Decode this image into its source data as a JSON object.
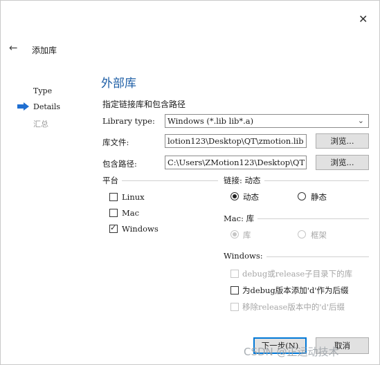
{
  "window": {
    "title": "添加库",
    "close_symbol": "✕",
    "back_symbol": "←"
  },
  "steps": [
    {
      "label": "Type",
      "active": false
    },
    {
      "label": "Details",
      "active": true
    },
    {
      "label": "汇总",
      "active": false
    }
  ],
  "page": {
    "title": "外部库",
    "subtitle": "指定链接库和包含路径"
  },
  "form": {
    "library_type": {
      "label": "Library type:",
      "value": "Windows (*.lib lib*.a)"
    },
    "library_file": {
      "label": "库文件:",
      "value": "lotion123\\Desktop\\QT\\zmotion.lib",
      "browse_label": "浏览..."
    },
    "include_path": {
      "label": "包含路径:",
      "value": "C:\\Users\\ZMotion123\\Desktop\\QT",
      "browse_label": "浏览..."
    }
  },
  "platform": {
    "title": "平台",
    "options": [
      {
        "label": "Linux",
        "checked": false
      },
      {
        "label": "Mac",
        "checked": false
      },
      {
        "label": "Windows",
        "checked": true
      }
    ]
  },
  "linking": {
    "title": "链接: 动态",
    "options": [
      {
        "label": "动态",
        "selected": true
      },
      {
        "label": "静态",
        "selected": false
      }
    ]
  },
  "mac": {
    "title": "Mac: 库",
    "options": [
      {
        "label": "库",
        "selected": true,
        "disabled": true
      },
      {
        "label": "框架",
        "selected": false,
        "disabled": true
      }
    ]
  },
  "windows": {
    "title": "Windows:",
    "options": [
      {
        "label": "debug或release子目录下的库",
        "checked": false,
        "disabled": true
      },
      {
        "label": "为debug版本添加'd'作为后缀",
        "checked": false,
        "disabled": false
      },
      {
        "label": "移除release版本中的'd'后缀",
        "checked": false,
        "disabled": true
      }
    ]
  },
  "footer": {
    "next_label": "下一步(N)",
    "cancel_label": "取消"
  },
  "watermark": "CSDN @正运动技术",
  "colors": {
    "accent": "#1f5fa6",
    "step_arrow": "#1f6fd1",
    "focus_border": "#0078d7"
  }
}
